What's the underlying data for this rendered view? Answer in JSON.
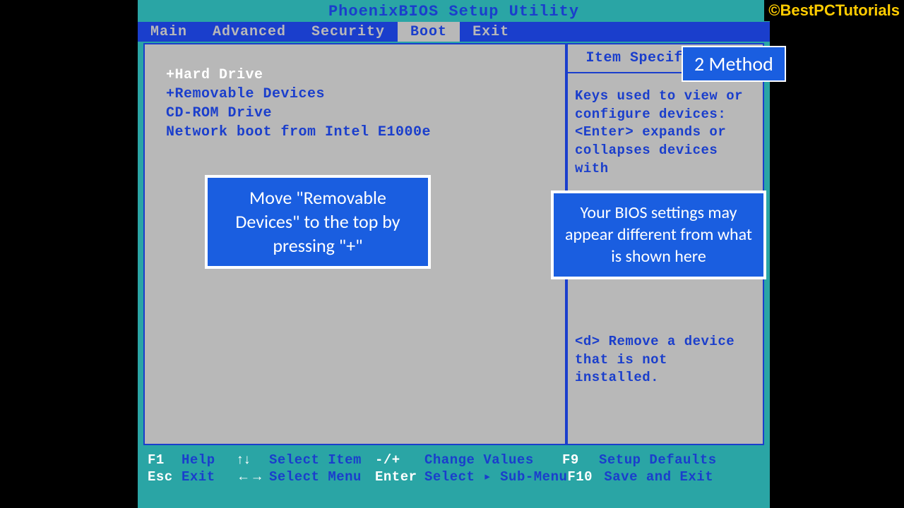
{
  "watermark": "©BestPCTutorials",
  "title": "PhoenixBIOS Setup Utility",
  "tabs": [
    "Main",
    "Advanced",
    "Security",
    "Boot",
    "Exit"
  ],
  "active_tab_index": 3,
  "boot_items": [
    {
      "label": "+Hard Drive",
      "cls": "white"
    },
    {
      "label": "+Removable Devices",
      "cls": "blue"
    },
    {
      "label": " CD-ROM Drive",
      "cls": "blue"
    },
    {
      "label": " Network boot from Intel E1000e",
      "cls": "blue"
    }
  ],
  "help": {
    "title": "Item Specific Help",
    "body_top": "Keys used to view or configure devices: <Enter> expands or collapses devices with",
    "body_bottom": "<d> Remove a device that is not installed."
  },
  "footer": {
    "r1": {
      "k1": "F1",
      "a1": "Help",
      "k2": "↑↓",
      "a2": "Select Item",
      "k3": "-/+",
      "a3": "Change Values",
      "k4": "F9",
      "a4": "Setup Defaults"
    },
    "r2": {
      "k1": "Esc",
      "a1": "Exit",
      "k2": "←→",
      "a2": "Select Menu",
      "k3": "Enter",
      "a3": "Select ▸ Sub-Menu",
      "k4": "F10",
      "a4": "Save and Exit"
    }
  },
  "callouts": {
    "badge": "2 Method",
    "move": "Move \"Removable Devices\" to the top by pressing \"+\"",
    "diff": "Your BIOS settings may appear different from what is shown here"
  }
}
